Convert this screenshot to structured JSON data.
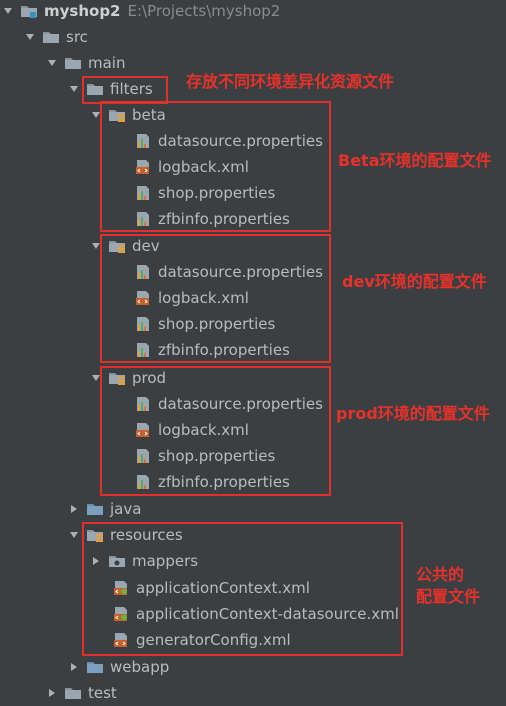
{
  "tree": {
    "project": {
      "name": "myshop2",
      "path": "E:\\Projects\\myshop2"
    },
    "src": "src",
    "main": "main",
    "filters": "filters",
    "beta": {
      "name": "beta",
      "files": [
        "datasource.properties",
        "logback.xml",
        "shop.properties",
        "zfbinfo.properties"
      ]
    },
    "dev": {
      "name": "dev",
      "files": [
        "datasource.properties",
        "logback.xml",
        "shop.properties",
        "zfbinfo.properties"
      ]
    },
    "prod": {
      "name": "prod",
      "files": [
        "datasource.properties",
        "logback.xml",
        "shop.properties",
        "zfbinfo.properties"
      ]
    },
    "java": "java",
    "resources": "resources",
    "mappers": "mappers",
    "resource_files": [
      "applicationContext.xml",
      "applicationContext-datasource.xml",
      "generatorConfig.xml"
    ],
    "webapp": "webapp",
    "test": "test"
  },
  "annotations": {
    "filters_note": "存放不同环境差异化资源文件",
    "beta_note": "Beta环境的配置文件",
    "dev_note": "dev环境的配置文件",
    "prod_note": "prod环境的配置文件",
    "resources_note_line1": "公共的",
    "resources_note_line2": "配置文件"
  },
  "colors": {
    "annotation": "#e8312a",
    "background": "#3c3f41",
    "text": "#bbbbbb"
  }
}
